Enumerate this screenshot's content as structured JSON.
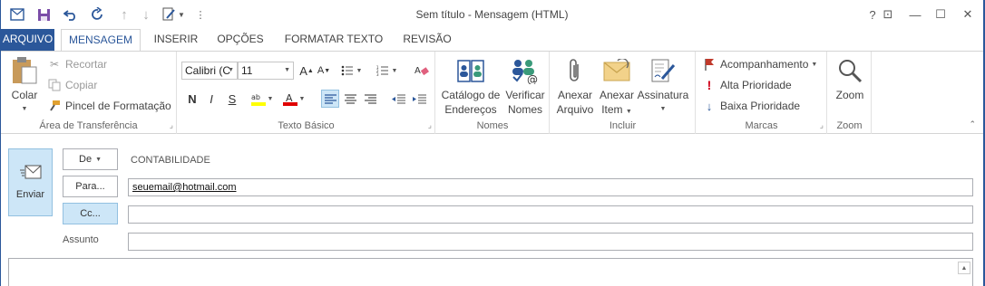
{
  "window": {
    "title": "Sem título - Mensagem (HTML)",
    "help": "?",
    "ribbon_display": "⊡",
    "minimize": "—",
    "maximize": "☐",
    "close": "✕"
  },
  "quick_access": {
    "customize": "⋮"
  },
  "tabs": [
    {
      "label": "ARQUIVO"
    },
    {
      "label": "MENSAGEM"
    },
    {
      "label": "INSERIR"
    },
    {
      "label": "OPÇÕES"
    },
    {
      "label": "FORMATAR TEXTO"
    },
    {
      "label": "REVISÃO"
    }
  ],
  "clipboard": {
    "paste": "Colar",
    "cut": "Recortar",
    "copy": "Copiar",
    "format_painter": "Pincel de Formatação",
    "title": "Área de Transferência"
  },
  "basic_text": {
    "font": "Calibri (C",
    "size": "11",
    "bold": "N",
    "italic": "I",
    "underline": "S",
    "title": "Texto Básico"
  },
  "names": {
    "address_book_line1": "Catálogo de",
    "address_book_line2": "Endereços",
    "check_names_line1": "Verificar",
    "check_names_line2": "Nomes",
    "title": "Nomes"
  },
  "include": {
    "attach_file_line1": "Anexar",
    "attach_file_line2": "Arquivo",
    "attach_item_line1": "Anexar",
    "attach_item_line2": "Item",
    "signature": "Assinatura",
    "title": "Incluir"
  },
  "tags": {
    "follow_up": "Acompanhamento",
    "high_priority": "Alta Prioridade",
    "low_priority": "Baixa Prioridade",
    "title": "Marcas"
  },
  "zoom": {
    "label": "Zoom",
    "title": "Zoom"
  },
  "compose": {
    "send": "Enviar",
    "from_button": "De",
    "from_value": "CONTABILIDADE",
    "to_button": "Para...",
    "to_value": "seuemail@hotmail.com",
    "cc_button": "Cc...",
    "cc_value": "",
    "subject_label": "Assunto",
    "subject_value": ""
  },
  "colors": {
    "accent": "#2b579a",
    "selected": "#cde6f7",
    "follow_up_flag": "#c0392b",
    "high_priority": "#d0021b",
    "low_priority": "#2b579a"
  }
}
